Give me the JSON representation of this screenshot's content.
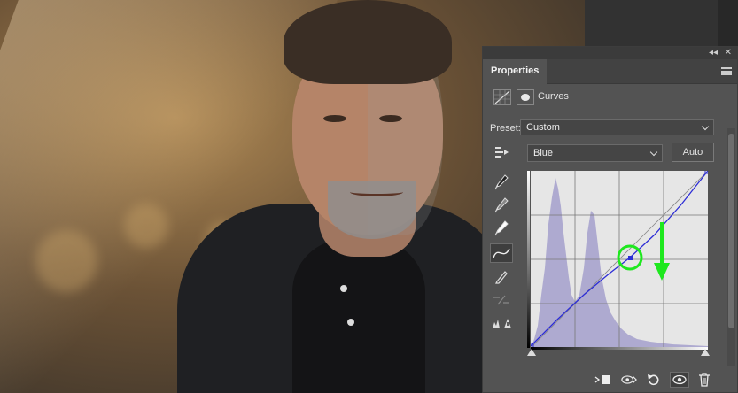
{
  "panel": {
    "tab_label": "Properties",
    "adjustment_title": "Curves",
    "preset_label": "Preset:",
    "preset_value": "Custom",
    "channel_value": "Blue",
    "auto_label": "Auto"
  },
  "panel_controls": {
    "collapse_glyph": "◂◂",
    "close_glyph": "✕"
  },
  "colors": {
    "curve": "#2d2dd6",
    "histogram": "#aeaad0",
    "highlight_ring": "#1ee81e",
    "arrow": "#1ee81e"
  },
  "icons": [
    "adjustment-layer-icon",
    "mask-icon",
    "on-image-adjust-icon",
    "black-eyedropper-icon",
    "gray-eyedropper-icon",
    "white-eyedropper-icon",
    "curve-points-icon",
    "pencil-icon",
    "smooth-icon",
    "clipping-warning-icon",
    "clip-to-layer-icon",
    "view-previous-icon",
    "reset-icon",
    "visibility-icon",
    "trash-icon"
  ]
}
